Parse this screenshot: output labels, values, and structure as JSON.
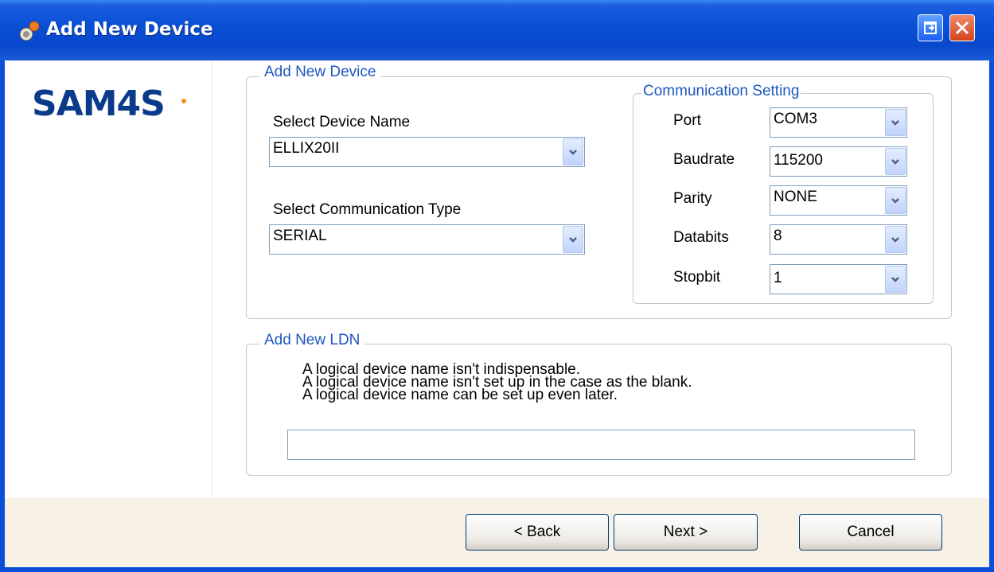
{
  "window": {
    "title": "Add New Device"
  },
  "logo": {
    "text": "SAM4S"
  },
  "device_group": {
    "title": "Add New Device",
    "device_name_label": "Select Device Name",
    "device_name_value": "ELLIX20II",
    "comm_type_label": "Select Communication Type",
    "comm_type_value": "SERIAL"
  },
  "comm_setting": {
    "title": "Communication Setting",
    "fields": [
      {
        "label": "Port",
        "value": "COM3"
      },
      {
        "label": "Baudrate",
        "value": "115200"
      },
      {
        "label": "Parity",
        "value": "NONE"
      },
      {
        "label": "Databits",
        "value": "8"
      },
      {
        "label": "Stopbit",
        "value": "1"
      }
    ]
  },
  "ldn_group": {
    "title": "Add New LDN",
    "lines": [
      "A logical device name isn't indispensable.",
      "A logical device name isn't set up in the case as the blank.",
      "A logical device name can be set up even later."
    ],
    "input_value": ""
  },
  "buttons": {
    "back": "< Back",
    "next": "Next >",
    "cancel": "Cancel"
  },
  "colors": {
    "titlebar": "#0a4fd6",
    "group_title": "#1f57c0",
    "logo": "#0a3a8a",
    "button_bar": "#f8f1e6"
  }
}
